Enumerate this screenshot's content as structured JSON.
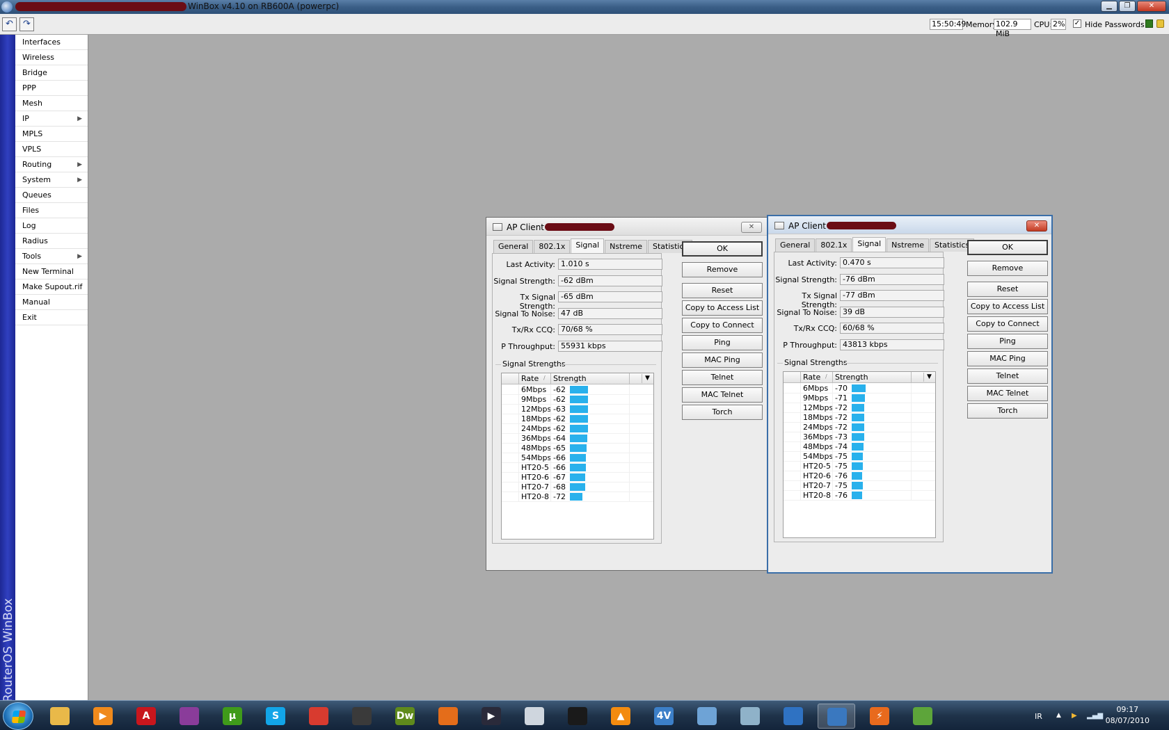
{
  "window": {
    "title": "WinBox v4.10 on RB600A (powerpc)"
  },
  "toolbar": {
    "time": "15:50:49",
    "memory_label": "Memory:",
    "memory_value": "102.9 MiB",
    "cpu_label": "CPU:",
    "cpu_value": "2%",
    "hide_passwords_label": "Hide Passwords",
    "hide_passwords_checked": "✓"
  },
  "sidebar": {
    "brand": "RouterOS WinBox",
    "items": [
      {
        "label": "Interfaces",
        "has_submenu": false
      },
      {
        "label": "Wireless",
        "has_submenu": false
      },
      {
        "label": "Bridge",
        "has_submenu": false
      },
      {
        "label": "PPP",
        "has_submenu": false
      },
      {
        "label": "Mesh",
        "has_submenu": false
      },
      {
        "label": "IP",
        "has_submenu": true
      },
      {
        "label": "MPLS",
        "has_submenu": false
      },
      {
        "label": "VPLS",
        "has_submenu": false
      },
      {
        "label": "Routing",
        "has_submenu": true
      },
      {
        "label": "System",
        "has_submenu": true
      },
      {
        "label": "Queues",
        "has_submenu": false
      },
      {
        "label": "Files",
        "has_submenu": false
      },
      {
        "label": "Log",
        "has_submenu": false
      },
      {
        "label": "Radius",
        "has_submenu": false
      },
      {
        "label": "Tools",
        "has_submenu": true
      },
      {
        "label": "New Terminal",
        "has_submenu": false
      },
      {
        "label": "Make Supout.rif",
        "has_submenu": false
      },
      {
        "label": "Manual",
        "has_submenu": false
      },
      {
        "label": "Exit",
        "has_submenu": false
      }
    ]
  },
  "dialogs": [
    {
      "title": "AP Client <",
      "active": false,
      "tabs": [
        "General",
        "802.1x",
        "Signal",
        "Nstreme",
        "Statistics"
      ],
      "selected_tab": "Signal",
      "fields": [
        {
          "label": "Last Activity:",
          "value": "1.010 s"
        },
        {
          "label": "Signal Strength:",
          "value": "-62 dBm"
        },
        {
          "label": "Tx Signal Strength:",
          "value": "-65 dBm"
        },
        {
          "label": "Signal To Noise:",
          "value": "47 dB"
        },
        {
          "label": "Tx/Rx CCQ:",
          "value": "70/68 %"
        },
        {
          "label": "P Throughput:",
          "value": "55931 kbps"
        }
      ],
      "group_title": "Signal Strengths",
      "columns": [
        "Rate",
        "Strength"
      ],
      "rows": [
        {
          "rate": "6Mbps",
          "strength": -62
        },
        {
          "rate": "9Mbps",
          "strength": -62
        },
        {
          "rate": "12Mbps",
          "strength": -63
        },
        {
          "rate": "18Mbps",
          "strength": -62
        },
        {
          "rate": "24Mbps",
          "strength": -62
        },
        {
          "rate": "36Mbps",
          "strength": -64
        },
        {
          "rate": "48Mbps",
          "strength": -65
        },
        {
          "rate": "54Mbps",
          "strength": -66
        },
        {
          "rate": "HT20-5",
          "strength": -66
        },
        {
          "rate": "HT20-6",
          "strength": -67
        },
        {
          "rate": "HT20-7",
          "strength": -68
        },
        {
          "rate": "HT20-8",
          "strength": -72
        }
      ],
      "buttons": [
        "OK",
        "Remove",
        "Reset",
        "Copy to Access List",
        "Copy to Connect List",
        "Ping",
        "MAC Ping",
        "Telnet",
        "MAC Telnet",
        "Torch"
      ]
    },
    {
      "title": "AP Client <",
      "active": true,
      "tabs": [
        "General",
        "802.1x",
        "Signal",
        "Nstreme",
        "Statistics"
      ],
      "selected_tab": "Signal",
      "fields": [
        {
          "label": "Last Activity:",
          "value": "0.470 s"
        },
        {
          "label": "Signal Strength:",
          "value": "-76 dBm"
        },
        {
          "label": "Tx Signal Strength:",
          "value": "-77 dBm"
        },
        {
          "label": "Signal To Noise:",
          "value": "39 dB"
        },
        {
          "label": "Tx/Rx CCQ:",
          "value": "60/68 %"
        },
        {
          "label": "P Throughput:",
          "value": "43813 kbps"
        }
      ],
      "group_title": "Signal Strengths",
      "columns": [
        "Rate",
        "Strength"
      ],
      "rows": [
        {
          "rate": "6Mbps",
          "strength": -70
        },
        {
          "rate": "9Mbps",
          "strength": -71
        },
        {
          "rate": "12Mbps",
          "strength": -72
        },
        {
          "rate": "18Mbps",
          "strength": -72
        },
        {
          "rate": "24Mbps",
          "strength": -72
        },
        {
          "rate": "36Mbps",
          "strength": -73
        },
        {
          "rate": "48Mbps",
          "strength": -74
        },
        {
          "rate": "54Mbps",
          "strength": -75
        },
        {
          "rate": "HT20-5",
          "strength": -75
        },
        {
          "rate": "HT20-6",
          "strength": -76
        },
        {
          "rate": "HT20-7",
          "strength": -75
        },
        {
          "rate": "HT20-8",
          "strength": -76
        }
      ],
      "buttons": [
        "OK",
        "Remove",
        "Reset",
        "Copy to Access List",
        "Copy to Connect List",
        "Ping",
        "MAC Ping",
        "Telnet",
        "MAC Telnet",
        "Torch"
      ]
    }
  ],
  "taskbar": {
    "apps": [
      {
        "name": "file-explorer-icon",
        "glyph": "",
        "color": "#e9b949"
      },
      {
        "name": "media-player-icon",
        "glyph": "▶",
        "color": "#f08a1c"
      },
      {
        "name": "acrobat-icon",
        "glyph": "A",
        "color": "#c8161d"
      },
      {
        "name": "winrar-icon",
        "glyph": "",
        "color": "#8a3c9a"
      },
      {
        "name": "utorrent-icon",
        "glyph": "µ",
        "color": "#3f9b1a"
      },
      {
        "name": "skype-icon",
        "glyph": "S",
        "color": "#12a5e8"
      },
      {
        "name": "chrome-icon",
        "glyph": "",
        "color": "#d83b2f"
      },
      {
        "name": "winamp-icon",
        "glyph": "",
        "color": "#3a3a3a"
      },
      {
        "name": "dreamweaver-icon",
        "glyph": "Dw",
        "color": "#5f8a1c"
      },
      {
        "name": "firefox-icon",
        "glyph": "",
        "color": "#e46d1a"
      },
      {
        "name": "video-player-icon",
        "glyph": "▶",
        "color": "#2a2a3a"
      },
      {
        "name": "disc-burner-icon",
        "glyph": "",
        "color": "#cfd6de"
      },
      {
        "name": "camera-icon",
        "glyph": "",
        "color": "#1a1a1a"
      },
      {
        "name": "vlc-icon",
        "glyph": "▲",
        "color": "#f38b0f"
      },
      {
        "name": "video-converter-icon",
        "glyph": "4V",
        "color": "#3c7fc8"
      },
      {
        "name": "disc-tool-icon",
        "glyph": "",
        "color": "#6ea3d6"
      },
      {
        "name": "messenger-icon",
        "glyph": "",
        "color": "#8fb2c9"
      },
      {
        "name": "network-tool-icon",
        "glyph": "",
        "color": "#2f72c2"
      },
      {
        "name": "winbox-icon",
        "glyph": "",
        "color": "#3a78bf"
      },
      {
        "name": "download-manager-icon",
        "glyph": "⚡",
        "color": "#e86a1d"
      },
      {
        "name": "network-users-icon",
        "glyph": "",
        "color": "#5da53a"
      }
    ],
    "language": "IR",
    "time": "09:17",
    "date": "08/07/2010"
  }
}
